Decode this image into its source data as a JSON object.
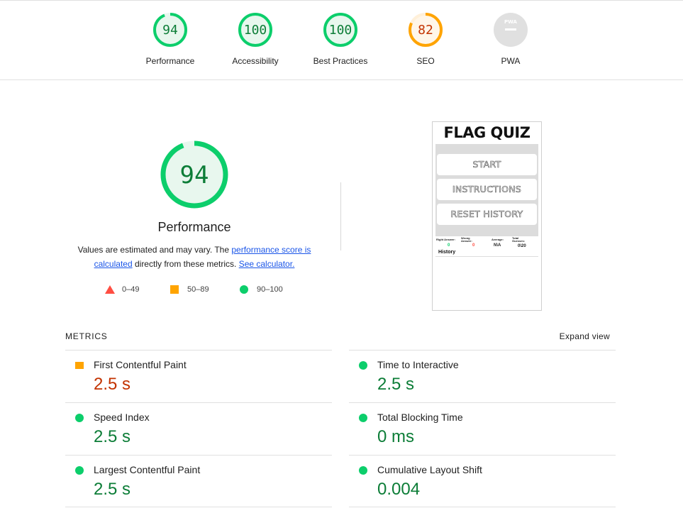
{
  "colors": {
    "pass": "#0c7d37",
    "pass_ring": "#0cce6b",
    "pass_fill": "#e8f7ee",
    "average": "#c33300",
    "average_ring": "#ffa400",
    "average_fill": "#fff6e9",
    "fail": "#ff4e42",
    "na": "#e0e0e0",
    "link": "#1a55e8"
  },
  "summary": {
    "gauges": [
      {
        "score": "94",
        "label": "Performance",
        "rating": "pass"
      },
      {
        "score": "100",
        "label": "Accessibility",
        "rating": "pass"
      },
      {
        "score": "100",
        "label": "Best Practices",
        "rating": "pass"
      },
      {
        "score": "82",
        "label": "SEO",
        "rating": "average"
      },
      {
        "score": "",
        "label": "PWA",
        "rating": "na",
        "badge_text": "PWA"
      }
    ]
  },
  "hero": {
    "score": "94",
    "title": "Performance",
    "desc_prefix": "Values are estimated and may vary. The ",
    "desc_link1": "performance score is calculated",
    "desc_middle": " directly from these metrics. ",
    "desc_link2": "See calculator.",
    "legend": [
      {
        "shape": "triangle",
        "range": "0–49"
      },
      {
        "shape": "square",
        "range": "50–89"
      },
      {
        "shape": "circle",
        "range": "90–100"
      }
    ]
  },
  "thumbnail": {
    "title": "FLAG QUIZ",
    "buttons": [
      "START",
      "INSTRUCTIONS",
      "RESET HISTORY"
    ],
    "stats": [
      {
        "label": "Right Answer:",
        "value": "0"
      },
      {
        "label": "Wrong Answer:",
        "value": "0"
      },
      {
        "label": "Average:",
        "value": "N\\A"
      },
      {
        "label": "Total Guesses:",
        "value": "0\\20"
      }
    ],
    "history_label": "History"
  },
  "metrics": {
    "title": "METRICS",
    "expand_label": "Expand view",
    "items": [
      {
        "name": "First Contentful Paint",
        "value": "2.5 s",
        "rating": "average"
      },
      {
        "name": "Time to Interactive",
        "value": "2.5 s",
        "rating": "pass"
      },
      {
        "name": "Speed Index",
        "value": "2.5 s",
        "rating": "pass"
      },
      {
        "name": "Total Blocking Time",
        "value": "0 ms",
        "rating": "pass"
      },
      {
        "name": "Largest Contentful Paint",
        "value": "2.5 s",
        "rating": "pass"
      },
      {
        "name": "Cumulative Layout Shift",
        "value": "0.004",
        "rating": "pass"
      }
    ]
  }
}
